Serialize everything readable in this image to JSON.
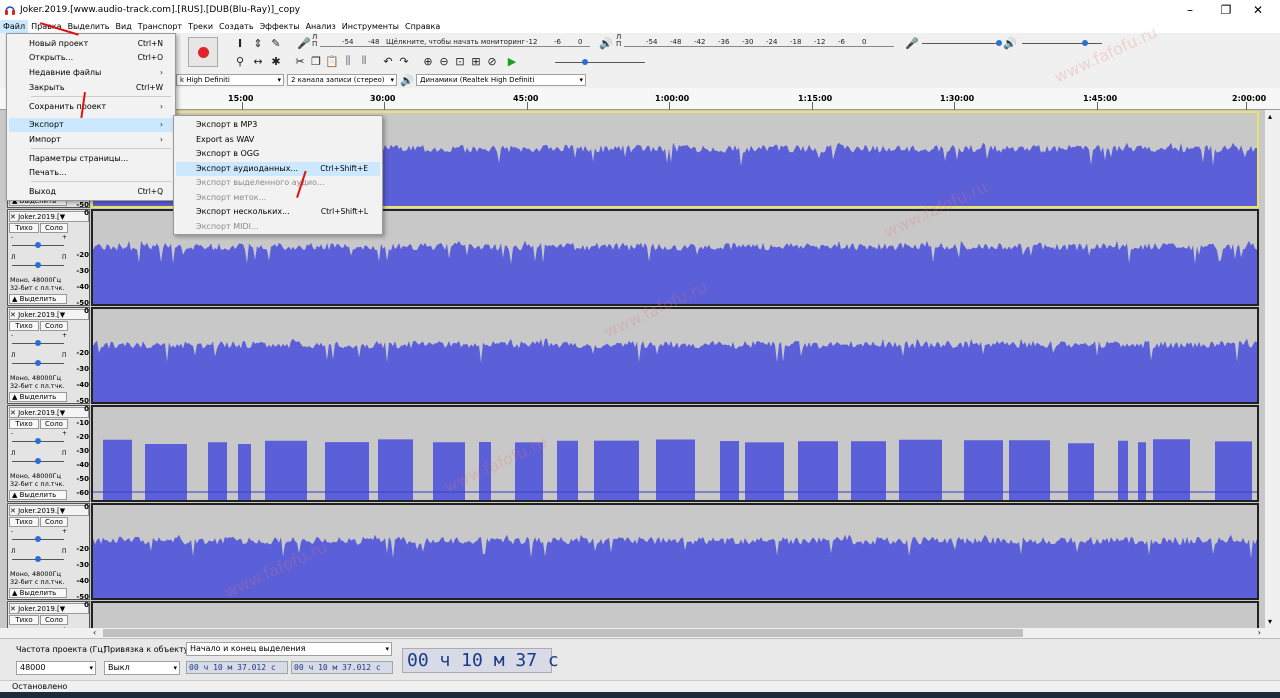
{
  "window": {
    "title": "Joker.2019.[www.audio-track.com].[RUS].[DUB(Blu-Ray)]_copy",
    "minimize": "–",
    "maximize": "❐",
    "close": "✕"
  },
  "menubar": [
    {
      "label": "Файл",
      "active": true
    },
    {
      "label": "Правка"
    },
    {
      "label": "Выделить"
    },
    {
      "label": "Вид"
    },
    {
      "label": "Транспорт"
    },
    {
      "label": "Треки"
    },
    {
      "label": "Создать"
    },
    {
      "label": "Эффекты"
    },
    {
      "label": "Анализ"
    },
    {
      "label": "Инструменты"
    },
    {
      "label": "Справка"
    }
  ],
  "toolbar": {
    "monitor_hint": "Щёлкните, чтобы начать мониторинг",
    "rec_meter_ticks": [
      "-54",
      "-48",
      "-12",
      "-6",
      "0"
    ],
    "play_meter_ticks": [
      "-54",
      "-48",
      "-42",
      "-36",
      "-30",
      "-24",
      "-18",
      "-12",
      "-6",
      "0"
    ],
    "rec_meter_ch": [
      "Л",
      "П"
    ],
    "play_meter_ch": [
      "Л",
      "П"
    ],
    "input_device": "k High Definiti",
    "channels": "2 канала записи (стерео)",
    "output_device": "Динамики (Realtek High Definiti",
    "accent": "#2a6fd4"
  },
  "ruler": {
    "ticks": [
      "15:00",
      "30:00",
      "45:00",
      "1:00:00",
      "1:15:00",
      "1:30:00",
      "1:45:00",
      "2:00:00"
    ]
  },
  "file_menu": {
    "items": [
      {
        "label": "Новый проект",
        "shortcut": "Ctrl+N"
      },
      {
        "label": "Открыть...",
        "shortcut": "Ctrl+O"
      },
      {
        "label": "Недавние файлы",
        "shortcut": "›"
      },
      {
        "label": "Закрыть",
        "shortcut": "Ctrl+W"
      },
      {
        "label": "Сохранить проект",
        "shortcut": "›"
      },
      {
        "label": "Экспорт",
        "shortcut": "›",
        "highlighted": true
      },
      {
        "label": "Импорт",
        "shortcut": "›"
      },
      {
        "label": "Параметры страницы..."
      },
      {
        "label": "Печать..."
      },
      {
        "label": "Выход",
        "shortcut": "Ctrl+Q"
      }
    ]
  },
  "export_menu": {
    "items": [
      {
        "label": "Экспорт в MP3"
      },
      {
        "label": "Export as WAV"
      },
      {
        "label": "Экспорт в OGG"
      },
      {
        "label": "Экспорт аудиоданных...",
        "shortcut": "Ctrl+Shift+E",
        "highlighted": true
      },
      {
        "label": "Экспорт выделенного аудио...",
        "disabled": true
      },
      {
        "label": "Экспорт меток...",
        "disabled": true
      },
      {
        "label": "Экспорт нескольких...",
        "shortcut": "Ctrl+Shift+L"
      },
      {
        "label": "Экспорт MIDI...",
        "disabled": true
      }
    ]
  },
  "track_common": {
    "name": "Joker.2019.[",
    "mute": "Тихо",
    "solo": "Соло",
    "info1": "Моно, 48000Гц",
    "info2": "32-бит с пл.тчк.",
    "select": "Выделить",
    "scale": [
      "0",
      "-10",
      "-20",
      "-30",
      "-40",
      "-50",
      "-60"
    ],
    "gain_ch": [
      "-",
      "+"
    ],
    "pan_ch": [
      "Л",
      "П"
    ],
    "wave_color": "#5b5fd8",
    "wave_dark": "#3a3ec8"
  },
  "selection_toolbar": {
    "rate_label": "Частота проекта (Гц)",
    "rate_value": "48000",
    "snap_label": "Привязка к объекту",
    "snap_value": "Выкл",
    "range_label": "Начало и конец выделения",
    "start_time": "00 ч 10 м 37.012 с",
    "end_time": "00 ч 10 м 37.012 с",
    "big_time": "00 ч 10 м 37 с"
  },
  "status": {
    "text": "Остановлено"
  },
  "watermark": "www.fafofu.ru"
}
